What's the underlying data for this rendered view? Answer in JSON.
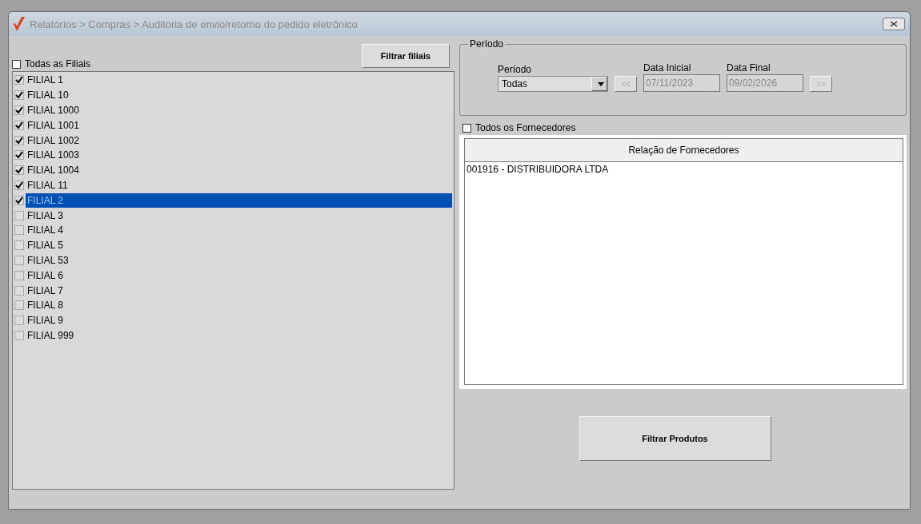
{
  "window": {
    "title": "Relatórios > Compras > Auditoria de envio/retorno do pedido eletrônico"
  },
  "branches": {
    "all_checkbox": {
      "label": "Todas as Filiais",
      "checked": false
    },
    "filter_button": "Filtrar filiais",
    "items": [
      {
        "label": "FILIAL 1",
        "checked": true,
        "selected": false
      },
      {
        "label": "FILIAL 10",
        "checked": true,
        "selected": false
      },
      {
        "label": "FILIAL 1000",
        "checked": true,
        "selected": false
      },
      {
        "label": "FILIAL 1001",
        "checked": true,
        "selected": false
      },
      {
        "label": "FILIAL 1002",
        "checked": true,
        "selected": false
      },
      {
        "label": "FILIAL 1003",
        "checked": true,
        "selected": false
      },
      {
        "label": "FILIAL 1004",
        "checked": true,
        "selected": false
      },
      {
        "label": "FILIAL 11",
        "checked": true,
        "selected": false
      },
      {
        "label": "FILIAL 2",
        "checked": true,
        "selected": true
      },
      {
        "label": "FILIAL 3",
        "checked": false,
        "selected": false
      },
      {
        "label": "FILIAL 4",
        "checked": false,
        "selected": false
      },
      {
        "label": "FILIAL 5",
        "checked": false,
        "selected": false
      },
      {
        "label": "FILIAL 53",
        "checked": false,
        "selected": false
      },
      {
        "label": "FILIAL 6",
        "checked": false,
        "selected": false
      },
      {
        "label": "FILIAL 7",
        "checked": false,
        "selected": false
      },
      {
        "label": "FILIAL 8",
        "checked": false,
        "selected": false
      },
      {
        "label": "FILIAL 9",
        "checked": false,
        "selected": false
      },
      {
        "label": "FILIAL 999",
        "checked": false,
        "selected": false
      }
    ]
  },
  "period": {
    "group_title": "Período",
    "period_label": "Período",
    "period_value": "Todas",
    "prev_button": "<<",
    "start_label": "Data Inicial",
    "start_value": "07/11/2023",
    "end_label": "Data Final",
    "end_value": "09/02/2026",
    "next_button": ">>"
  },
  "suppliers": {
    "all_checkbox": {
      "label": "Todos os Fornecedores",
      "checked": false
    },
    "header": "Relação de Fornecedores",
    "items": [
      {
        "label": "001916 - DISTRIBUIDORA LTDA"
      }
    ]
  },
  "filter_products_button": "Filtrar Produtos"
}
